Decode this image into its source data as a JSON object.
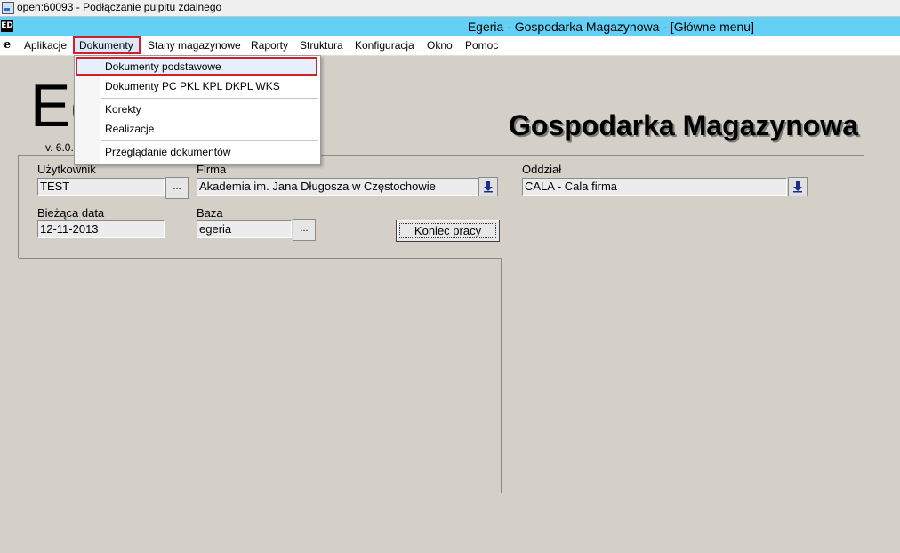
{
  "window": {
    "title": "open:60093 - Podłączanie pulpitu zdalnego"
  },
  "app": {
    "title": "Egeria - Gospodarka Magazynowa - [Główne menu]",
    "icon": "ED"
  },
  "menu": {
    "items": [
      "Aplikacje",
      "Dokumenty",
      "Stany magazynowe",
      "Raporty",
      "Struktura",
      "Konfiguracja",
      "Okno",
      "Pomoc"
    ],
    "active": "Dokumenty"
  },
  "dropdown": {
    "items": [
      "Dokumenty podstawowe",
      "Dokumenty  PC PKL KPL DKPL WKS",
      "Korekty",
      "Realizacje",
      "Przeglądanie dokumentów"
    ],
    "highlighted": "Dokumenty podstawowe"
  },
  "logo": {
    "text": "Eg",
    "version": "v. 6.0."
  },
  "heading": "Gospodarka Magazynowa",
  "form": {
    "user_label": "Użytkownik",
    "user_value": "TEST",
    "firma_label": "Firma",
    "firma_value": "Akademia im. Jana Długosza w Częstochowie",
    "oddzial_label": "Oddział",
    "oddzial_value": "CALA - Cala firma",
    "date_label": "Bieżąca data",
    "date_value": "12-11-2013",
    "baza_label": "Baza",
    "baza_value": "egeria",
    "ellipsis": "...",
    "exit_label": "Koniec pracy"
  },
  "colors": {
    "titlebar": "#63d0f5",
    "highlight_border": "#d31f2a",
    "background": "#d4d0c8"
  }
}
